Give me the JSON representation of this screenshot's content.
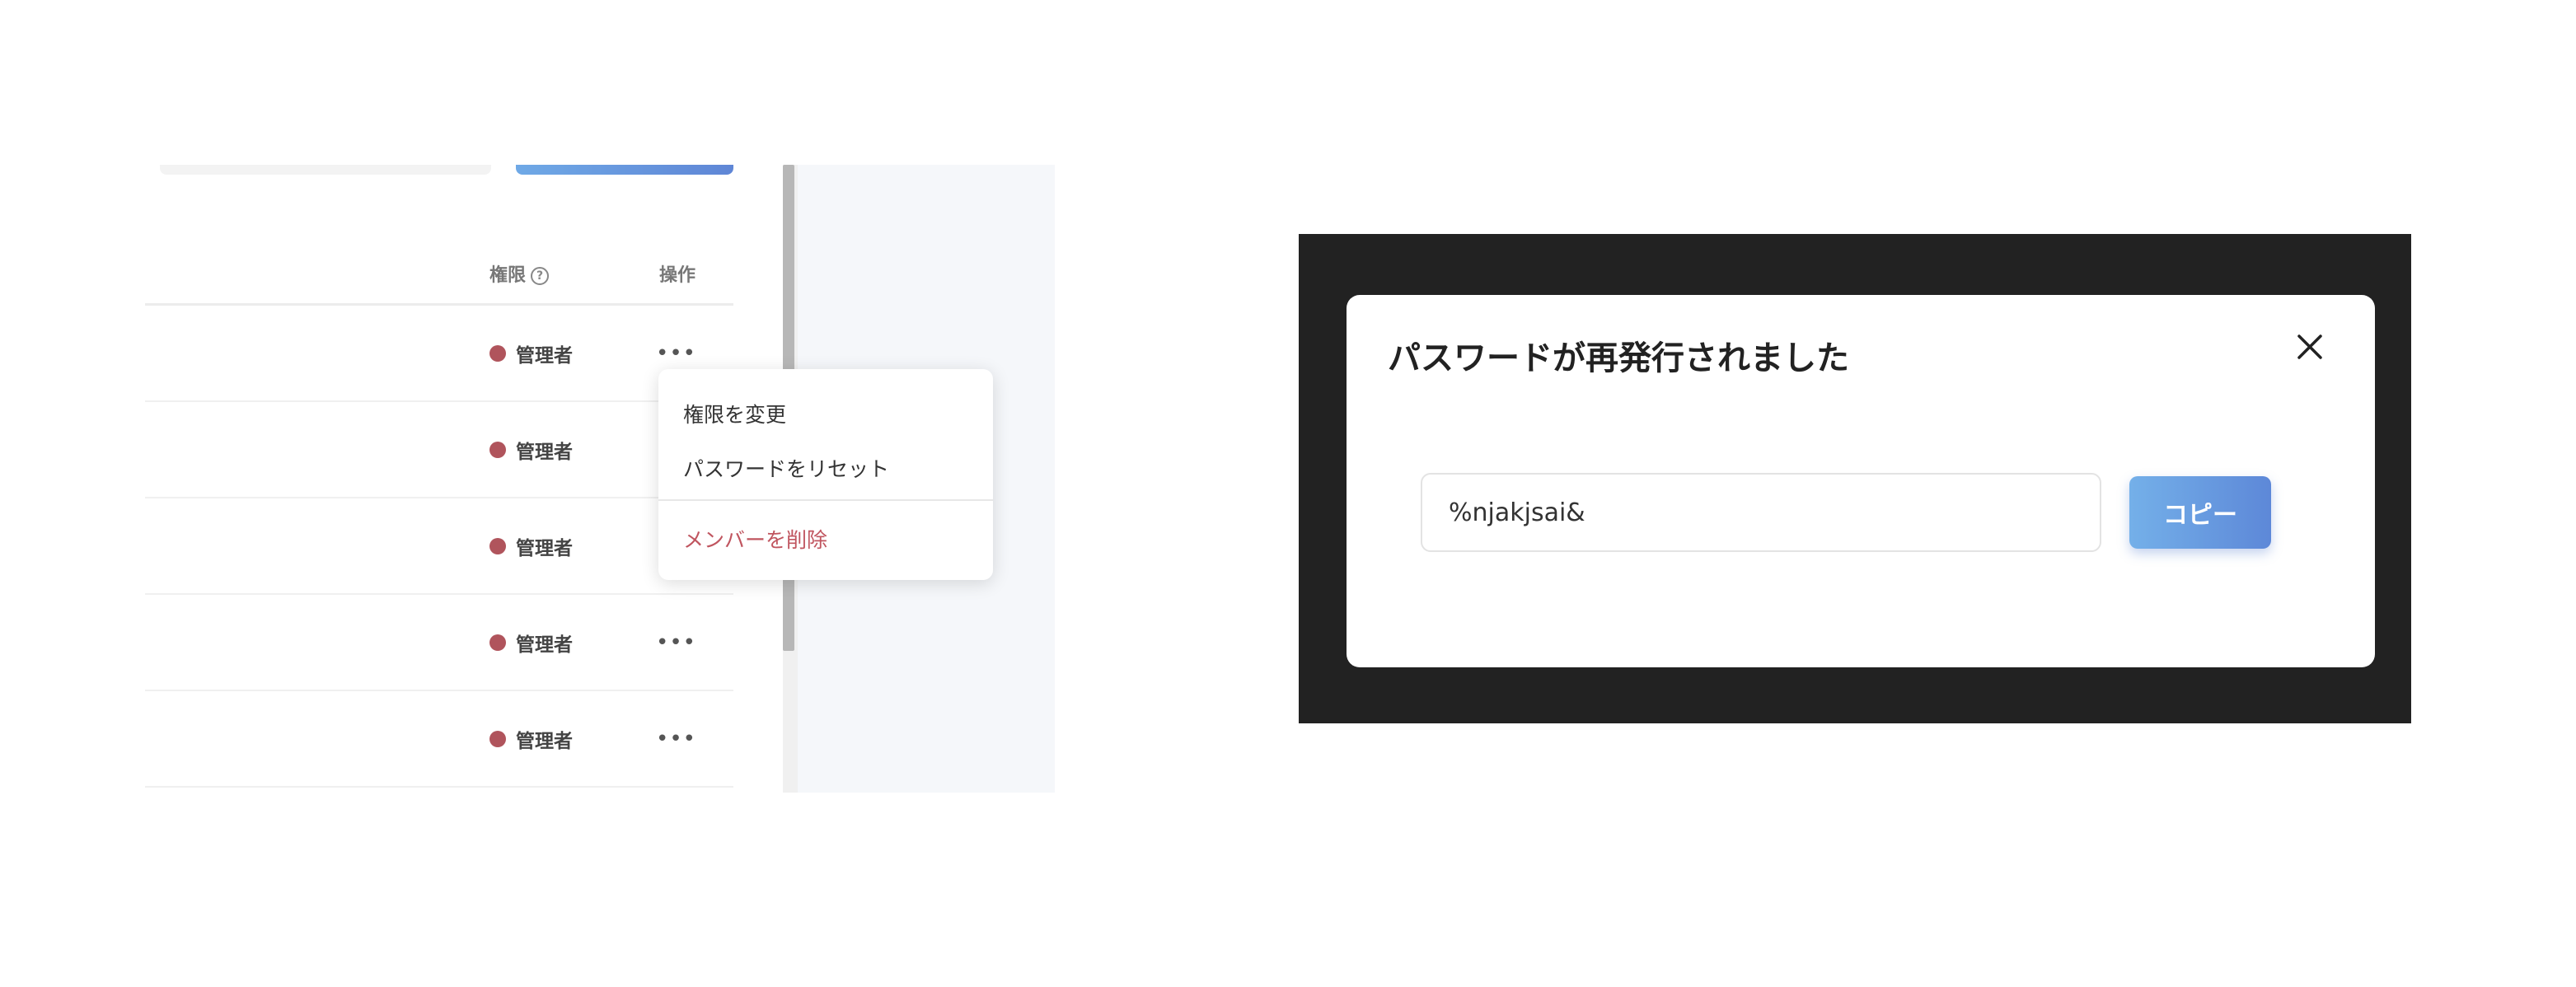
{
  "member_table": {
    "columns": {
      "permission": "権限",
      "actions": "操作"
    },
    "rows": [
      {
        "role": "管理者",
        "more": "•••"
      },
      {
        "role": "管理者",
        "more": ""
      },
      {
        "role": "管理者",
        "more": ""
      },
      {
        "role": "管理者",
        "more": "•••"
      },
      {
        "role": "管理者",
        "more": "•••"
      }
    ],
    "role_color": "#b0545c"
  },
  "context_menu": {
    "items": [
      "権限を変更",
      "パスワードをリセット"
    ],
    "danger_item": "メンバーを削除",
    "danger_color": "#c0555f"
  },
  "dialog": {
    "title": "パスワードが再発行されました",
    "password_value": "%njakjsai&",
    "copy_label": "コピー",
    "close_icon": "close-icon",
    "accent_color": "#5d88d8",
    "overlay_color": "#222222"
  }
}
